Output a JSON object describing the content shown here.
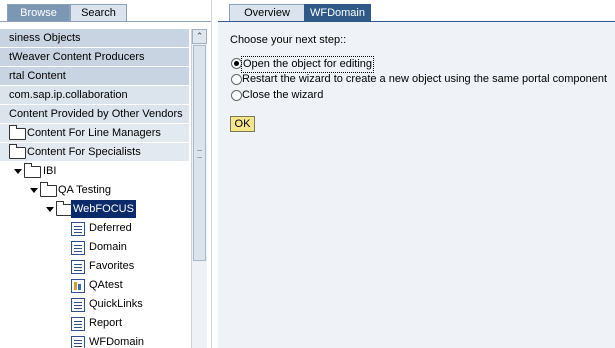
{
  "left_tabs": {
    "browse": "Browse",
    "search": "Search"
  },
  "tree": {
    "top_rows": [
      "siness Objects",
      "tWeaver Content Producers",
      "rtal Content",
      "com.sap.ip.collaboration",
      "Content Provided by Other Vendors"
    ],
    "folders": {
      "line_managers": "Content For Line Managers",
      "specialists": "Content For Specialists",
      "ibi": "IBI",
      "qa_testing": "QA Testing",
      "webfocus": "WebFOCUS"
    },
    "items": [
      {
        "label": "Deferred",
        "icon": "list-icon"
      },
      {
        "label": "Domain",
        "icon": "list-icon"
      },
      {
        "label": "Favorites",
        "icon": "list-icon"
      },
      {
        "label": "QAtest",
        "icon": "report-icon"
      },
      {
        "label": "QuickLinks",
        "icon": "list-icon"
      },
      {
        "label": "Report",
        "icon": "list-icon"
      },
      {
        "label": "WFDomain",
        "icon": "list-icon"
      }
    ],
    "scroll_up_glyph": "⌃"
  },
  "right_tabs": {
    "overview": "Overview",
    "wfdomain": "WFDomain"
  },
  "wizard": {
    "prompt": "Choose your next step::",
    "options": [
      {
        "label": "Open the object for editing",
        "selected": true
      },
      {
        "label": "Restart the wizard to create a new object using the same portal component",
        "selected": false
      },
      {
        "label": "Close the wizard",
        "selected": false
      }
    ],
    "ok_label": "OK"
  },
  "colors": {
    "tab_active": "#7c97b3",
    "tab_right_active": "#2f5a88",
    "selection": "#0a2a6a",
    "ok_button": "#f5e58c",
    "panel_bg": "#eff3f7"
  }
}
